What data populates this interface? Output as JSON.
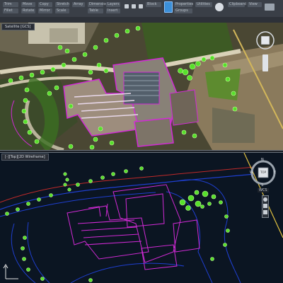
{
  "ribbon": {
    "buttons": [
      "Trim",
      "Fillet",
      "Move",
      "Rotate",
      "Copy",
      "Mirror",
      "Stretch",
      "Scale",
      "Array",
      "Dimension",
      "Table",
      "Layers",
      "Insert",
      "Block",
      "Properties",
      "Groups",
      "Utilities",
      "Clipboard",
      "View"
    ],
    "accent": "#3b8fd8"
  },
  "viewports": {
    "top": {
      "label": "Satellite [GCS]"
    },
    "bottom": {
      "label": "[-][Top][2D Wireframe]"
    }
  },
  "navigation": {
    "compass": [
      "N",
      "W",
      "E",
      "S"
    ],
    "cube_label": "TOP",
    "wcs_label": "WCS"
  },
  "colors": {
    "tree": "#57e02b",
    "building": "#d22ad6",
    "road": "#1f3fd0",
    "boundary": "#e0c040",
    "road_red": "#c02a2a"
  }
}
